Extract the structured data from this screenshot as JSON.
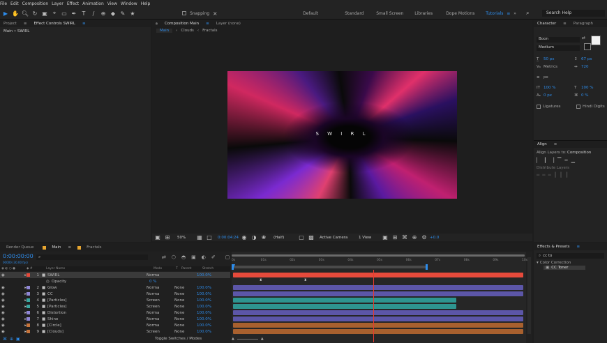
{
  "menu": [
    "File",
    "Edit",
    "Composition",
    "Layer",
    "Effect",
    "Animation",
    "View",
    "Window",
    "Help"
  ],
  "toolbar": {
    "snapping": "Snapping",
    "workspaces": [
      "Default",
      "Standard",
      "Small Screen",
      "Libraries",
      "Dope Motions",
      "Tutorials"
    ],
    "active_workspace": "Tutorials",
    "search_placeholder": "Search Help"
  },
  "left_panel": {
    "tabs": [
      "Project",
      "Effect Controls SWIRL"
    ],
    "subtitle": "Main • SWIRL"
  },
  "comp_panel": {
    "tab": "Composition Main",
    "layer_tab": "Layer (none)",
    "breadcrumbs": [
      "Main",
      "Clouds",
      "Fractals"
    ],
    "title_text": "S W I R L",
    "zoom": "50%",
    "timecode": "0:00:04:24",
    "resolution": "(Half)",
    "camera": "Active Camera",
    "views": "1 View",
    "exposure": "+0.0"
  },
  "character": {
    "tabs": [
      "Character",
      "Paragraph"
    ],
    "font": "Boon",
    "style": "Medium",
    "size": "50 px",
    "leading": "67 px",
    "tracking": "720",
    "kerning": "Metrics",
    "stroke": "px",
    "vscale": "100 %",
    "hscale": "100 %",
    "baseline": "0 px",
    "tsume": "0 %",
    "ligatures": "Ligatures",
    "hindi": "Hindi Digits"
  },
  "align": {
    "tab": "Align",
    "align_to_label": "Align Layers to:",
    "align_to_value": "Composition",
    "distribute": "Distribute Layers"
  },
  "effects": {
    "tab": "Effects & Presets",
    "search": "cc to",
    "category": "Color Correction",
    "item": "CC Toner"
  },
  "timeline": {
    "tabs": [
      "Render Queue",
      "Main",
      "Fractals"
    ],
    "timecode": "0:00:00:00",
    "fps": "00000 (30.00 fps)",
    "columns": [
      "Layer Name",
      "Mode",
      "T",
      "Parent",
      "Stretch"
    ],
    "ruler": [
      "0s",
      "01s",
      "02s",
      "03s",
      "04s",
      "05s",
      "06s",
      "07s",
      "08s",
      "09s",
      "10s"
    ],
    "footer": "Toggle Switches / Modes",
    "layers": [
      {
        "num": "1",
        "name": "SWIRL",
        "mode": "Norma",
        "parent": "",
        "stretch": "100.0%",
        "color": "#e64a3b",
        "bar": "#e64a3b"
      },
      {
        "num": "",
        "name": "Opacity",
        "mode": "",
        "parent": "",
        "stretch": "",
        "color": "",
        "bar": "",
        "value": "0 %"
      },
      {
        "num": "2",
        "name": "Glow",
        "mode": "Norma",
        "parent": "None",
        "stretch": "100.0%",
        "color": "#8f86d6",
        "bar": "#5c56a8"
      },
      {
        "num": "3",
        "name": "CC",
        "mode": "Norma",
        "parent": "None",
        "stretch": "100.0%",
        "color": "#8f86d6",
        "bar": "#5c56a8"
      },
      {
        "num": "4",
        "name": "[Particles]",
        "mode": "Screen",
        "parent": "None",
        "stretch": "100.0%",
        "color": "#3aa6a0",
        "bar": "#2e9590"
      },
      {
        "num": "5",
        "name": "[Particles]",
        "mode": "Screen",
        "parent": "None",
        "stretch": "100.0%",
        "color": "#3aa6a0",
        "bar": "#2e9590"
      },
      {
        "num": "6",
        "name": "Distortion",
        "mode": "Norma",
        "parent": "None",
        "stretch": "100.0%",
        "color": "#8f86d6",
        "bar": "#5c56a8"
      },
      {
        "num": "7",
        "name": "Shine",
        "mode": "Norma",
        "parent": "None",
        "stretch": "100.0%",
        "color": "#8f86d6",
        "bar": "#5c56a8"
      },
      {
        "num": "8",
        "name": "[Circle]",
        "mode": "Norma",
        "parent": "None",
        "stretch": "100.0%",
        "color": "#c8743a",
        "bar": "#a8602e"
      },
      {
        "num": "9",
        "name": "[Clouds]",
        "mode": "Screen",
        "parent": "None",
        "stretch": "100.0%",
        "color": "#c8743a",
        "bar": "#a8602e"
      }
    ]
  },
  "colors": {
    "accent": "#2d8ceb",
    "playhead": "#e83a2e"
  }
}
